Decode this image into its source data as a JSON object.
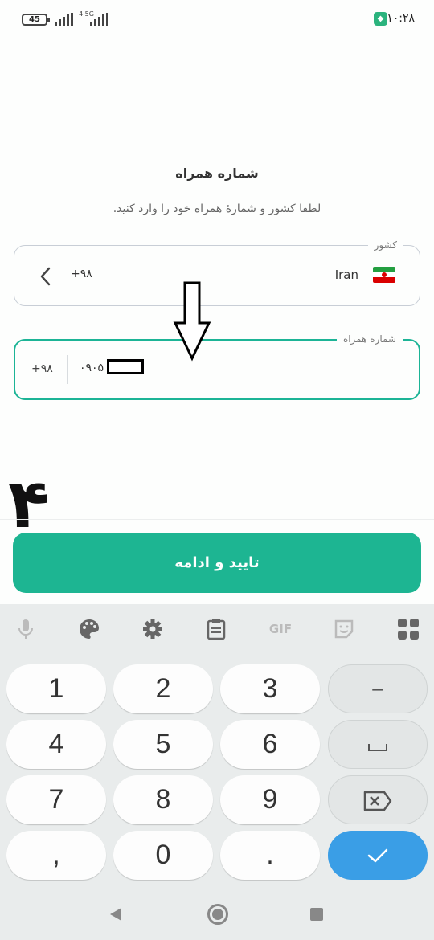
{
  "status": {
    "battery": "45",
    "network": "4.5G",
    "time": "۱۰:۲۸",
    "vpn_icon": "shield-icon"
  },
  "page": {
    "title": "شماره همراه",
    "subtitle": "لطفا کشور و شمارهٔ همراه خود را وارد کنید."
  },
  "country_field": {
    "legend": "کشور",
    "code": "+۹۸",
    "name": "Iran",
    "flag_colors": [
      "#239f40",
      "#ffffff",
      "#da0000"
    ]
  },
  "phone_field": {
    "legend": "شماره همراه",
    "prefix": "+۹۸",
    "value": "۰۹۰۵      ۶۰"
  },
  "annotation": {
    "number": "۴"
  },
  "confirm_button": {
    "label": "تایید و ادامه",
    "color": "#1db592"
  },
  "keyboard": {
    "toolbar": [
      "mic-icon",
      "palette-icon",
      "gear-icon",
      "clipboard-icon",
      "GIF",
      "sticker-icon",
      "grid-icon"
    ],
    "rows": [
      [
        "1",
        "2",
        "3",
        "−"
      ],
      [
        "4",
        "5",
        "6",
        "␣"
      ],
      [
        "7",
        "8",
        "9",
        "⌫"
      ],
      [
        ",",
        "0",
        ".",
        "✓"
      ]
    ],
    "accent": "#3a9ee6"
  }
}
